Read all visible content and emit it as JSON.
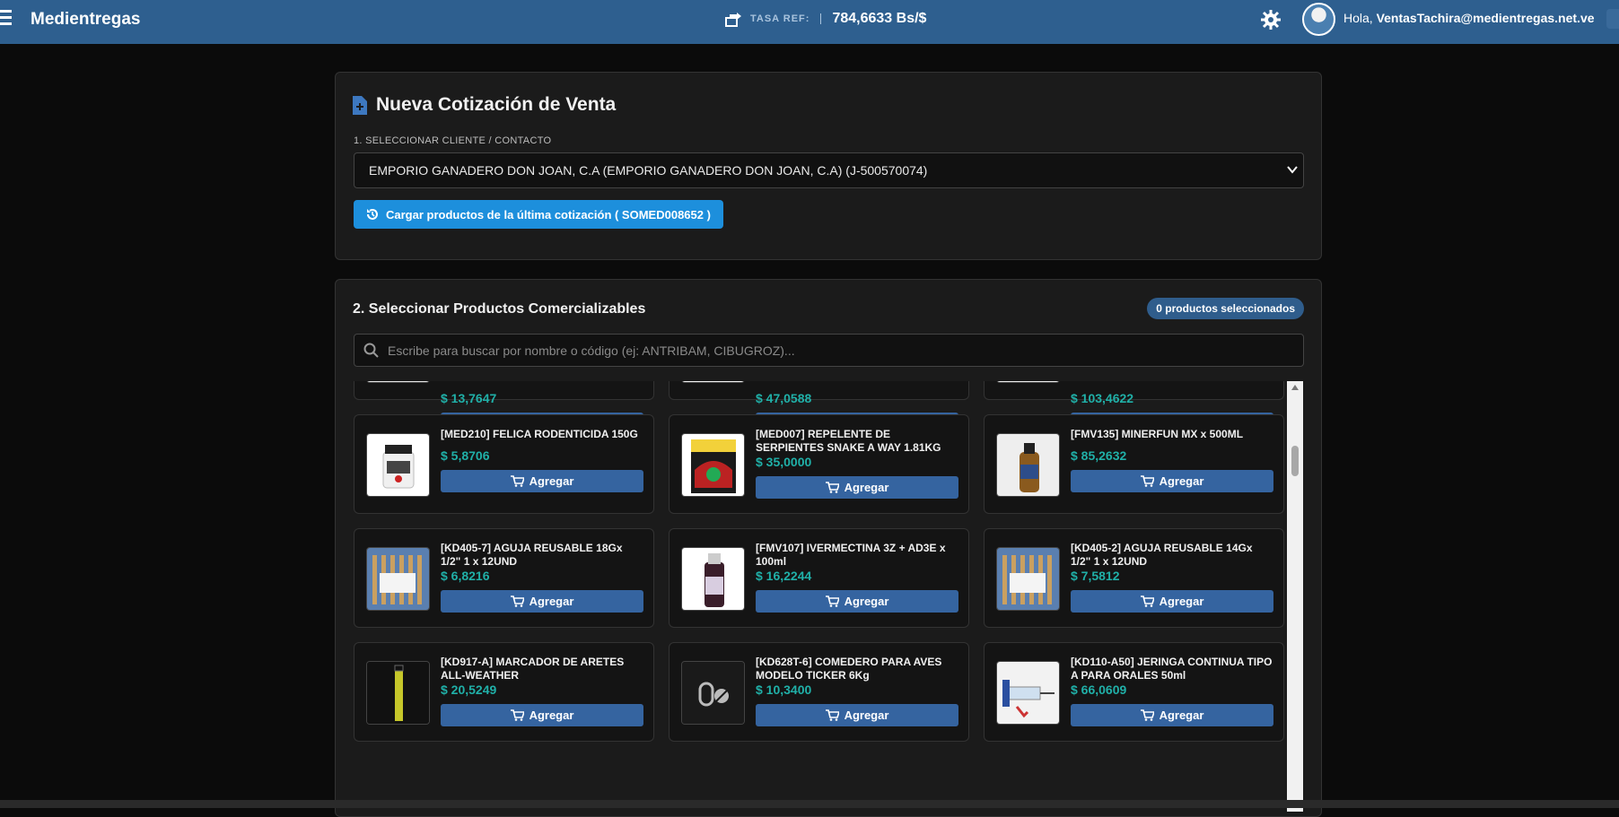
{
  "topbar": {
    "brand": "Medientregas",
    "rate_label": "TASA REF:",
    "rate_value": "784,6633 Bs/$",
    "greeting_prefix": "Hola, ",
    "user_email": "VentasTachira@medientregas.net.ve",
    "brand_color": "#2e5f8f"
  },
  "quote": {
    "title": "Nueva Cotización de Venta",
    "client_label": "1. SELECCIONAR CLIENTE / CONTACTO",
    "client_value": "EMPORIO GANADERO DON JOAN, C.A (EMPORIO GANADERO DON JOAN, C.A) (J-500570074)",
    "load_button": "Cargar productos de la última cotización (  SOMED008652  )"
  },
  "products_section": {
    "title": "2. Seleccionar Productos Comercializables",
    "badge": "0 productos seleccionados",
    "search_placeholder": "Escribe para buscar por nombre o código (ej: ANTRIBAM, CIBUGROZ)...",
    "add_label": "Agregar",
    "items": [
      {
        "name": "",
        "price": "$ 13,7647",
        "image": "vet-bottle-blue-label"
      },
      {
        "name": "",
        "price": "$ 47,0588",
        "image": "vet-bottle-dark-box"
      },
      {
        "name": "",
        "price": "$ 103,4622",
        "image": "vet-bottle-purple-box"
      },
      {
        "name": "[MED210] FELICA RODENTICIDA 150G",
        "price": "$ 5,8706",
        "image": "white-jar"
      },
      {
        "name": "[MED007] REPELENTE DE SERPIENTES SNAKE A WAY 1.81KG",
        "price": "$ 35,0000",
        "image": "repellent-bag"
      },
      {
        "name": "[FMV135] MINERFUN MX x 500ML",
        "price": "$ 85,2632",
        "image": "amber-bottle"
      },
      {
        "name": "[KD405-7] AGUJA REUSABLE 18Gx 1/2\" 1 x 12UND",
        "price": "$ 6,8216",
        "image": "needle-pack"
      },
      {
        "name": "[FMV107] IVERMECTINA 3Z + AD3E x 100ml",
        "price": "$ 16,2244",
        "image": "dark-bottle"
      },
      {
        "name": "[KD405-2] AGUJA REUSABLE 14Gx 1/2\" 1 x 12UND",
        "price": "$ 7,5812",
        "image": "needle-pack"
      },
      {
        "name": "[KD917-A] MARCADOR DE ARETES ALL-WEATHER",
        "price": "$ 20,5249",
        "image": "marker"
      },
      {
        "name": "[KD628T-6] COMEDERO PARA AVES MODELO TICKER 6Kg",
        "price": "$ 10,3400",
        "image": "pills-icon"
      },
      {
        "name": "[KD110-A50] JERINGA CONTINUA TIPO A PARA ORALES 50ml",
        "price": "$ 66,0609",
        "image": "syringe"
      }
    ]
  }
}
